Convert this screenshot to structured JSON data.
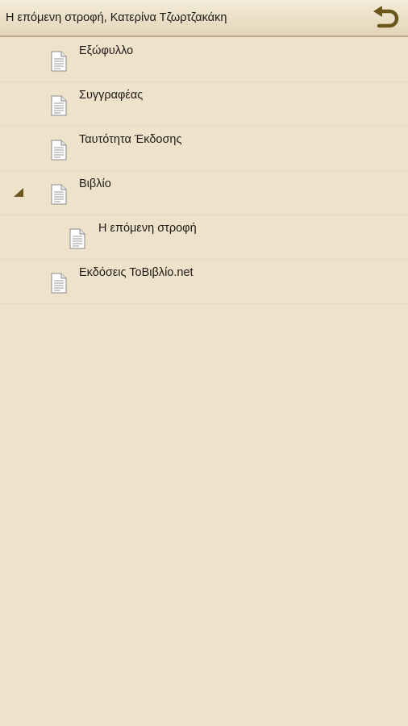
{
  "header": {
    "title": "Η επόμενη στροφή, Κατερίνα Τζωρτζακάκη",
    "back_icon": "undo-arrow-icon",
    "accent_color": "#6b561c"
  },
  "toc": {
    "items": [
      {
        "label": "Εξώφυλλο",
        "level": 0,
        "expanded": false,
        "icon": "document-icon"
      },
      {
        "label": "Συγγραφέας",
        "level": 0,
        "expanded": false,
        "icon": "document-icon"
      },
      {
        "label": "Ταυτότητα Έκδοσης",
        "level": 0,
        "expanded": false,
        "icon": "document-icon"
      },
      {
        "label": "Βιβλίο",
        "level": 0,
        "expanded": true,
        "icon": "document-icon"
      },
      {
        "label": "Η επόμενη στροφή",
        "level": 1,
        "expanded": false,
        "icon": "document-icon"
      },
      {
        "label": "Εκδόσεις ΤοΒιβλίο.net",
        "level": 0,
        "expanded": false,
        "icon": "document-icon"
      }
    ]
  },
  "colors": {
    "background": "#eee2cb",
    "divider": "#e4d8bf",
    "header_border": "#b9a98a"
  }
}
